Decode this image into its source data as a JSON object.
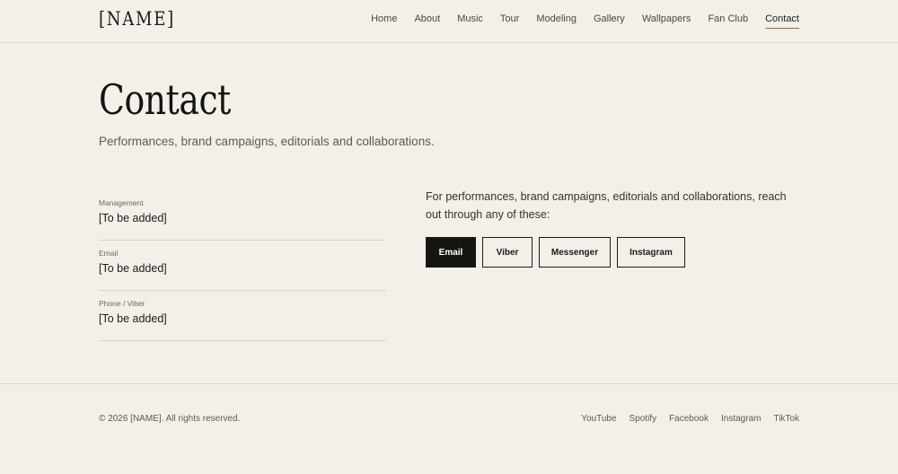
{
  "header": {
    "logo": "[NAME]",
    "nav": [
      {
        "label": "Home"
      },
      {
        "label": "About"
      },
      {
        "label": "Music"
      },
      {
        "label": "Tour"
      },
      {
        "label": "Modeling"
      },
      {
        "label": "Gallery"
      },
      {
        "label": "Wallpapers"
      },
      {
        "label": "Fan Club"
      },
      {
        "label": "Contact",
        "active": true
      }
    ]
  },
  "hero": {
    "title": "Contact",
    "subtitle": "Performances, brand campaigns, editorials and collaborations."
  },
  "contacts": [
    {
      "label": "Management",
      "value": "[To be added]"
    },
    {
      "label": "Email",
      "value": "[To be added]"
    },
    {
      "label": "Phone / Viber",
      "value": "[To be added]"
    }
  ],
  "intro": "For performances, brand campaigns, editorials and collaborations, reach out through any of these:",
  "buttons": [
    {
      "label": "Email",
      "primary": true
    },
    {
      "label": "Viber"
    },
    {
      "label": "Messenger"
    },
    {
      "label": "Instagram"
    }
  ],
  "footer": {
    "copyright": "© 2026 [NAME]. All rights reserved.",
    "social": [
      "YouTube",
      "Spotify",
      "Facebook",
      "Instagram",
      "TikTok"
    ]
  },
  "colors": {
    "background": "#f3f0ea",
    "text": "#1c1b19",
    "accent_underline": "#9a6b3c",
    "primary_button": "#151411"
  }
}
